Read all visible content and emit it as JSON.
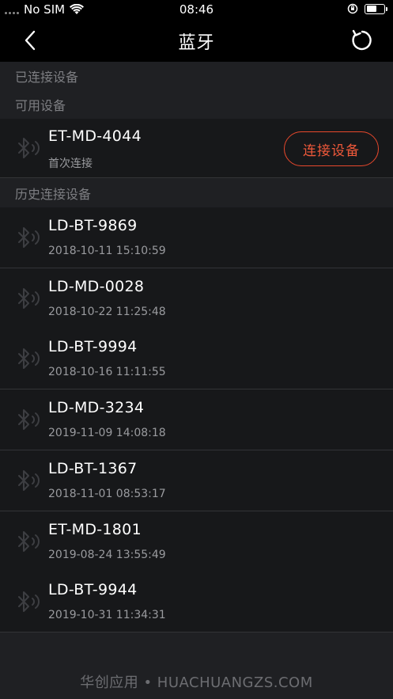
{
  "status_bar": {
    "carrier": "No SIM",
    "time": "08:46",
    "battery_level": 0.6
  },
  "nav": {
    "title": "蓝牙",
    "back_icon": "chevron-left-icon",
    "refresh_icon": "refresh-icon"
  },
  "sections": {
    "connected": "已连接设备",
    "available": "可用设备",
    "history": "历史连接设备"
  },
  "available_device": {
    "name": "ET-MD-4044",
    "subtitle": "首次连接",
    "button_label": "连接设备"
  },
  "history_devices": [
    {
      "name": "LD-BT-9869",
      "time": "2018-10-11 15:10:59"
    },
    {
      "name": "LD-MD-0028",
      "time": "2018-10-22 11:25:48"
    },
    {
      "name": "LD-BT-9994",
      "time": "2018-10-16 11:11:55"
    },
    {
      "name": "LD-MD-3234",
      "time": "2019-11-09 14:08:18"
    },
    {
      "name": "LD-BT-1367",
      "time": "2018-11-01 08:53:17"
    },
    {
      "name": "ET-MD-1801",
      "time": "2019-08-24 13:55:49"
    },
    {
      "name": "LD-BT-9944",
      "time": "2019-10-31 11:34:31"
    }
  ],
  "watermark": "华创应用 • HUACHUANGZS.COM",
  "colors": {
    "accent": "#e8482c",
    "background": "#1f2023",
    "row_background": "#17181a",
    "bar_background": "#000000"
  }
}
